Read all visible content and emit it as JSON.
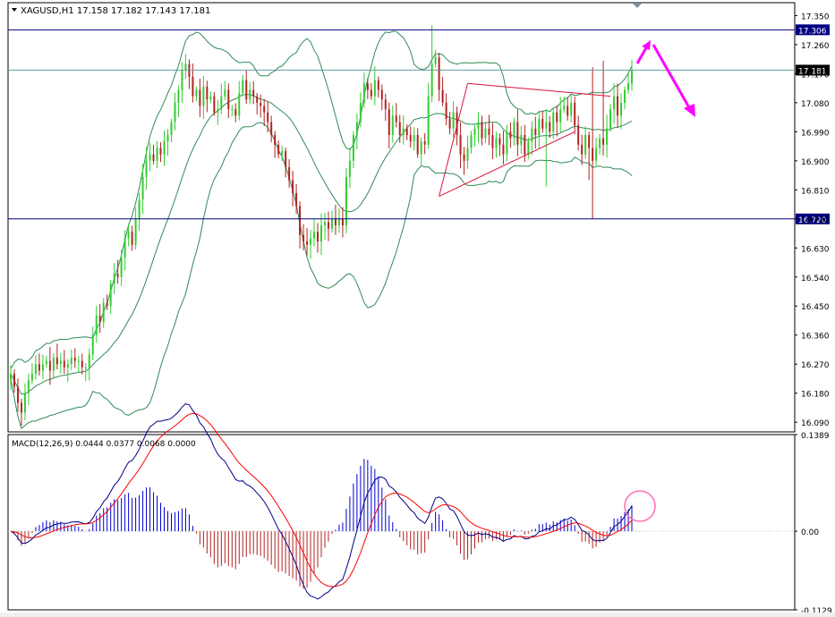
{
  "header": {
    "symbol_line": "XAGUSD,H1  17.158 17.182 17.143 17.181"
  },
  "macd": {
    "label": "MACD(12,26,9) 0.0444 0.0377 0.0068 0.0000"
  },
  "chart_data": [
    {
      "type": "candlestick",
      "title": "",
      "symbol": "XAGUSD",
      "timeframe": "H1",
      "ohlc_header": {
        "open": 17.158,
        "high": 17.182,
        "low": 17.143,
        "close": 17.181
      },
      "ylim": [
        16.06,
        17.39
      ],
      "y_ticks": [
        "17.350",
        "17.260",
        "17.170",
        "17.080",
        "16.990",
        "16.900",
        "16.810",
        "16.720",
        "16.630",
        "16.540",
        "16.450",
        "16.360",
        "16.270",
        "16.180",
        "16.090"
      ],
      "y_tick_values": [
        17.35,
        17.26,
        17.17,
        17.08,
        16.99,
        16.9,
        16.81,
        16.72,
        16.63,
        16.54,
        16.45,
        16.36,
        16.27,
        16.18,
        16.09
      ],
      "horizontal_levels": [
        {
          "value": 17.306,
          "label": "17.306",
          "color": "#000080"
        },
        {
          "value": 17.181,
          "label": "17.181",
          "color": "#000000"
        },
        {
          "value": 16.72,
          "label": "16.720",
          "color": "#000080"
        }
      ],
      "bar_count": 175,
      "closes": [
        16.24,
        16.2,
        16.15,
        16.12,
        16.18,
        16.22,
        16.24,
        16.27,
        16.25,
        16.27,
        16.28,
        16.25,
        16.29,
        16.27,
        16.28,
        16.26,
        16.27,
        16.29,
        16.28,
        16.28,
        16.26,
        16.26,
        16.3,
        16.36,
        16.42,
        16.4,
        16.46,
        16.45,
        16.52,
        16.55,
        16.54,
        16.6,
        16.66,
        16.68,
        16.64,
        16.72,
        16.78,
        16.85,
        16.9,
        16.92,
        16.9,
        16.94,
        16.92,
        16.96,
        16.98,
        17.02,
        17.08,
        17.12,
        17.18,
        17.2,
        17.16,
        17.1,
        17.12,
        17.07,
        17.13,
        17.09,
        17.1,
        17.05,
        17.06,
        17.1,
        17.12,
        17.06,
        17.06,
        17.04,
        17.11,
        17.15,
        17.09,
        17.12,
        17.1,
        17.08,
        17.07,
        17.05,
        17.02,
        16.98,
        16.95,
        16.92,
        16.93,
        16.88,
        16.84,
        16.8,
        16.76,
        16.67,
        16.65,
        16.64,
        16.66,
        16.68,
        16.65,
        16.7,
        16.71,
        16.69,
        16.72,
        16.7,
        16.72,
        16.7,
        16.85,
        16.9,
        16.98,
        17.02,
        17.08,
        17.14,
        17.12,
        17.1,
        17.15,
        17.12,
        17.09,
        17.06,
        16.98,
        17.04,
        17.02,
        16.98,
        17.0,
        16.98,
        16.96,
        16.98,
        16.92,
        16.96,
        16.95,
        17.1,
        17.2,
        17.22,
        17.12,
        17.08,
        17.03,
        17.0,
        17.05,
        16.98,
        16.92,
        16.9,
        16.94,
        16.98,
        17.0,
        17.02,
        16.97,
        17.0,
        16.98,
        16.94,
        16.97,
        16.95,
        16.92,
        16.99,
        16.97,
        17.02,
        16.95,
        16.98,
        16.92,
        16.96,
        17.0,
        16.98,
        17.03,
        17.0,
        17.02,
        16.99,
        17.05,
        17.02,
        17.06,
        17.07,
        17.04,
        17.08,
        17.01,
        16.95,
        16.92,
        16.98,
        16.94,
        16.9,
        16.94,
        16.97,
        16.95,
        17.0,
        17.06,
        17.1,
        17.04,
        17.08,
        17.12,
        17.14,
        17.181
      ]
    },
    {
      "type": "bar",
      "title": "",
      "indicator": "MACD",
      "params": [
        12,
        26,
        9
      ],
      "values_header": {
        "macd": 0.0444,
        "signal": 0.0377,
        "histogram": 0.0068,
        "extra": 0.0
      },
      "ylim": [
        -0.1129,
        0.1389
      ],
      "y_ticks": [
        "0.1389",
        "0.00",
        "-0.1129"
      ],
      "y_tick_values": [
        0.1389,
        0.0,
        -0.1129
      ],
      "zero_line": 0.0
    }
  ]
}
